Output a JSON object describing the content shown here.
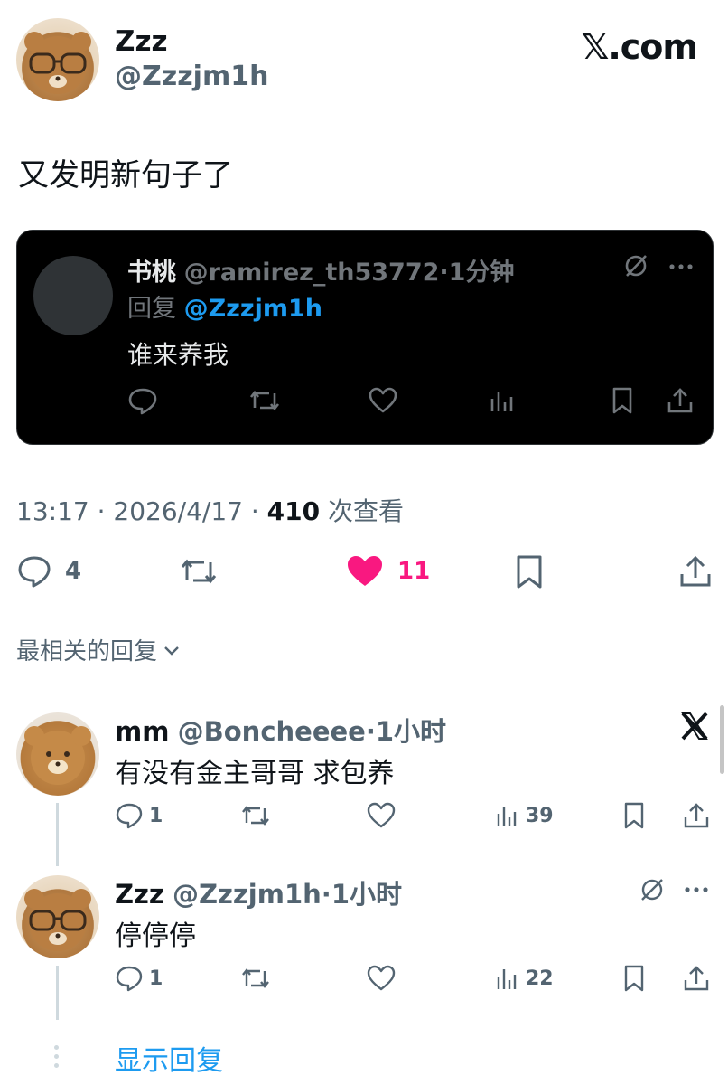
{
  "post": {
    "author_name": "Zzz",
    "author_handle": "@Zzzjm1h",
    "site_label": "𝕏.com",
    "text": "又发明新句子了"
  },
  "quoted": {
    "name": "书桃",
    "handle": "@ramirez_th53772",
    "time": "·1分钟",
    "reply_prefix": "回复",
    "reply_to": "@Zzzjm1h",
    "text": "谁来养我"
  },
  "meta": {
    "time": "13:17 · 2026/4/17 · ",
    "views": "410",
    "views_label": " 次查看"
  },
  "actions": {
    "reply_count": "4",
    "like_count": "11",
    "liked": true
  },
  "sort_label": "最相关的回复",
  "replies": [
    {
      "name": "mm",
      "handle": "@Boncheeee",
      "time": "·1小时",
      "text": "有没有金主哥哥 求包养",
      "reply_count": "1",
      "views": "39"
    },
    {
      "name": "Zzz",
      "handle": "@Zzzjm1h",
      "time": "·1小时",
      "text": "停停停",
      "reply_count": "1",
      "views": "22"
    }
  ],
  "show_replies_label": "显示回复",
  "colors": {
    "like": "#f91880",
    "link": "#1d9bf0",
    "muted": "#536471",
    "text": "#0f1419"
  }
}
